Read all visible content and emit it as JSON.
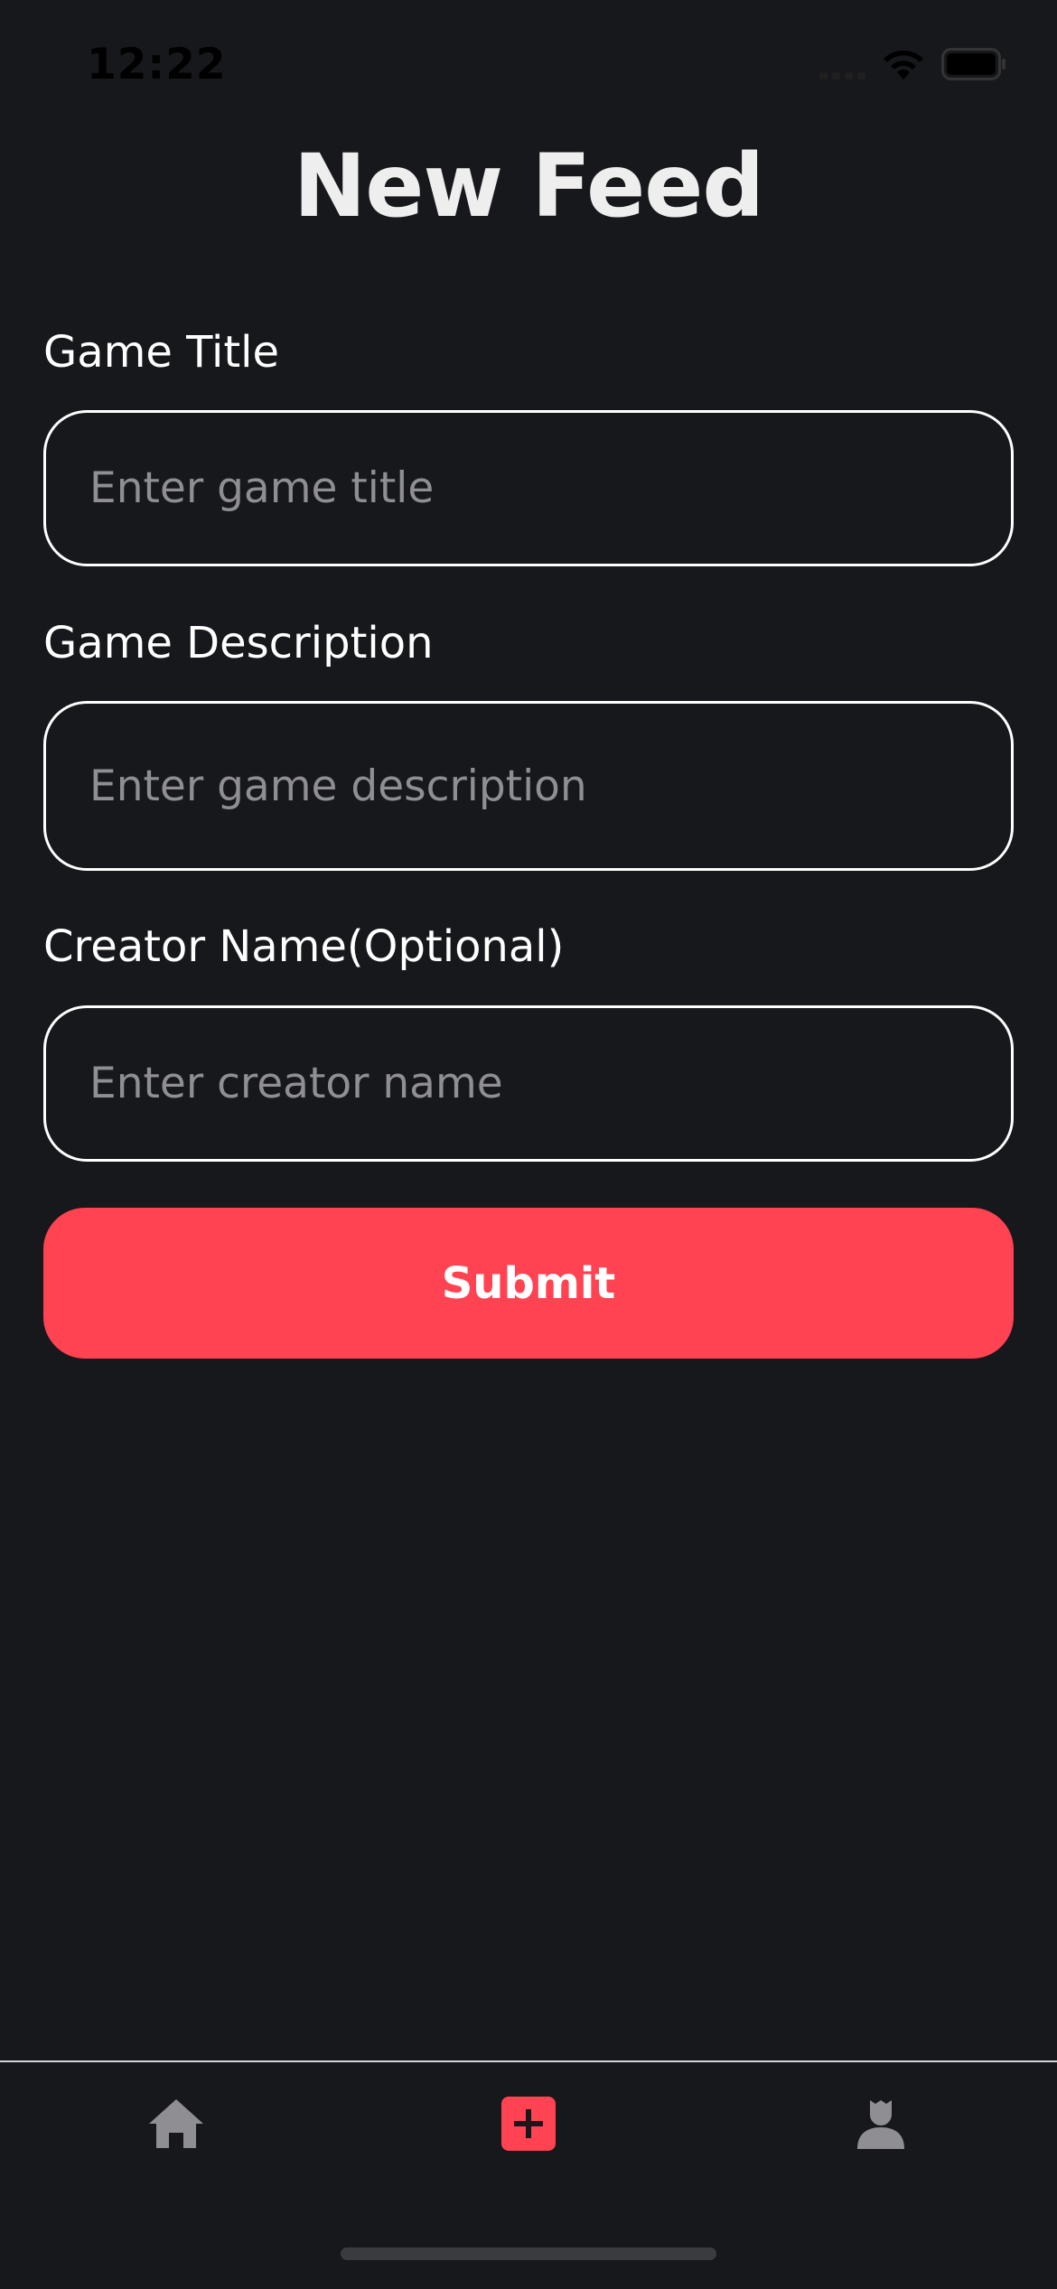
{
  "status_bar": {
    "time": "12:22"
  },
  "page": {
    "title": "New Feed"
  },
  "form": {
    "game_title": {
      "label": "Game Title",
      "placeholder": "Enter game title",
      "value": ""
    },
    "game_description": {
      "label": "Game Description",
      "placeholder": "Enter game description",
      "value": ""
    },
    "creator_name": {
      "label": "Creator Name(Optional)",
      "placeholder": "Enter creator name",
      "value": ""
    },
    "submit_label": "Submit"
  },
  "tab_bar": {
    "tabs": [
      {
        "icon": "home-icon",
        "active": false
      },
      {
        "icon": "add-icon",
        "active": true
      },
      {
        "icon": "profile-icon",
        "active": false
      }
    ]
  },
  "colors": {
    "background": "#17181b",
    "accent": "#ff4352",
    "inactive_icon": "#8e8e93",
    "input_border": "#ffffff",
    "placeholder": "#8e8e93"
  }
}
